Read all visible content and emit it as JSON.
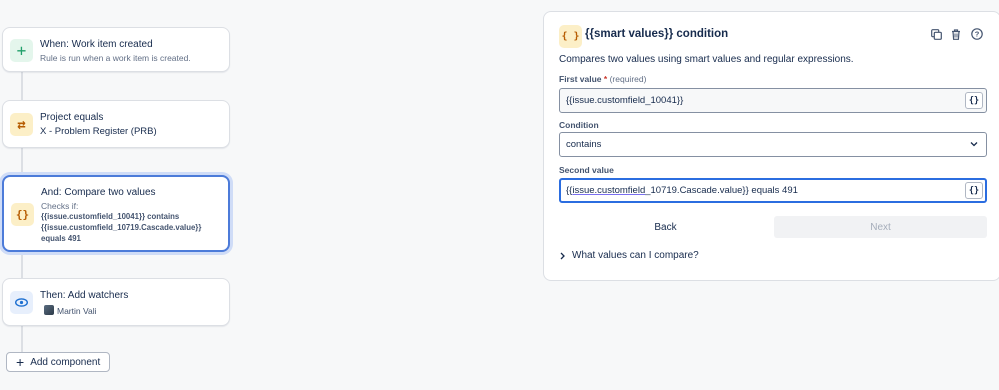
{
  "flow": {
    "trigger": {
      "title": "When: Work item created",
      "subtitle": "Rule is run when a work item is created.",
      "icon": "plus-icon"
    },
    "project_condition": {
      "title": "Project equals",
      "value": "X - Problem Register (PRB)",
      "icon": "swap-arrows-icon"
    },
    "compare_condition": {
      "title": "And: Compare two values",
      "checks_label": "Checks if:",
      "line1": "{{issue.customfield_10041}} contains",
      "line2": "{{issue.customfield_10719.Cascade.value}}",
      "line3": "equals 491",
      "icon": "braces-icon"
    },
    "action": {
      "title": "Then: Add watchers",
      "user": "Martin Vali",
      "icon": "eye-icon"
    },
    "add_component_label": "Add component"
  },
  "panel": {
    "icon_glyph": "{ }",
    "title": "{{smart values}} condition",
    "description": "Compares two values using smart values and regular expressions.",
    "first_value": {
      "label": "First value",
      "required_mark": "*",
      "hint": "(required)",
      "value": "{{issue.customfield_10041}}"
    },
    "condition": {
      "label": "Condition",
      "value": "contains"
    },
    "second_value": {
      "label": "Second value",
      "value_prefix": "{{",
      "value_underlined": "issue.customfield",
      "value_rest": "_10719.Cascade.value}} equals 491"
    },
    "brace_button": "{}",
    "back_label": "Back",
    "next_label": "Next",
    "expander_label": "What values can I compare?"
  },
  "colors": {
    "accent": "#2b6de0",
    "selected_border": "#4c7bd9",
    "required": "#c9372c"
  }
}
